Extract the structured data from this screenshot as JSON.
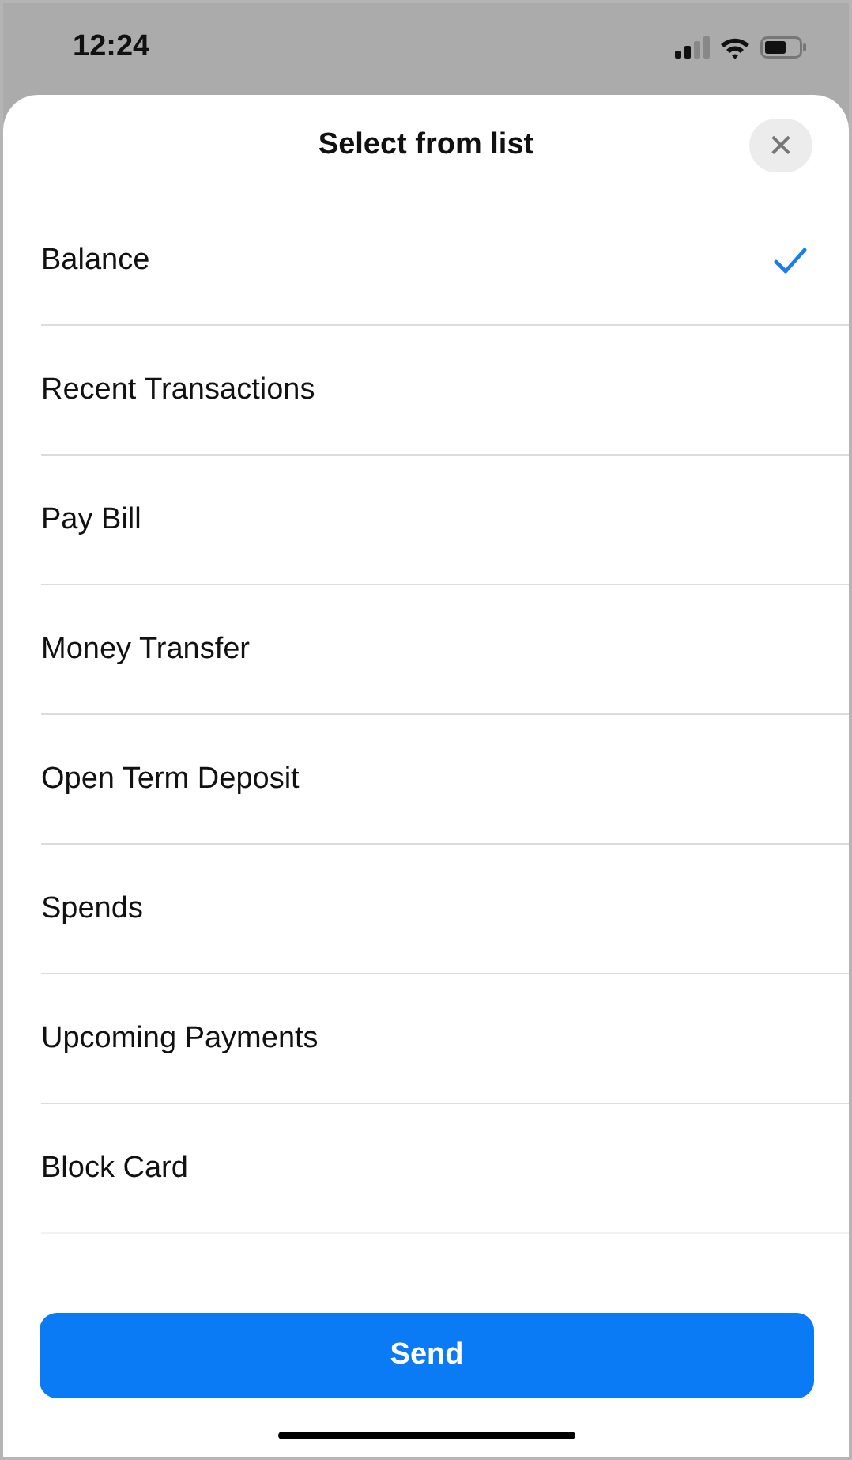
{
  "status_bar": {
    "time": "12:24"
  },
  "sheet": {
    "title": "Select from list",
    "close_label": "✕"
  },
  "options": [
    {
      "label": "Balance",
      "selected": true
    },
    {
      "label": "Recent Transactions",
      "selected": false
    },
    {
      "label": "Pay Bill",
      "selected": false
    },
    {
      "label": "Money Transfer",
      "selected": false
    },
    {
      "label": "Open Term Deposit",
      "selected": false
    },
    {
      "label": "Spends",
      "selected": false
    },
    {
      "label": "Upcoming Payments",
      "selected": false
    },
    {
      "label": "Block Card",
      "selected": false
    }
  ],
  "buttons": [
    {
      "label": "Send"
    }
  ]
}
